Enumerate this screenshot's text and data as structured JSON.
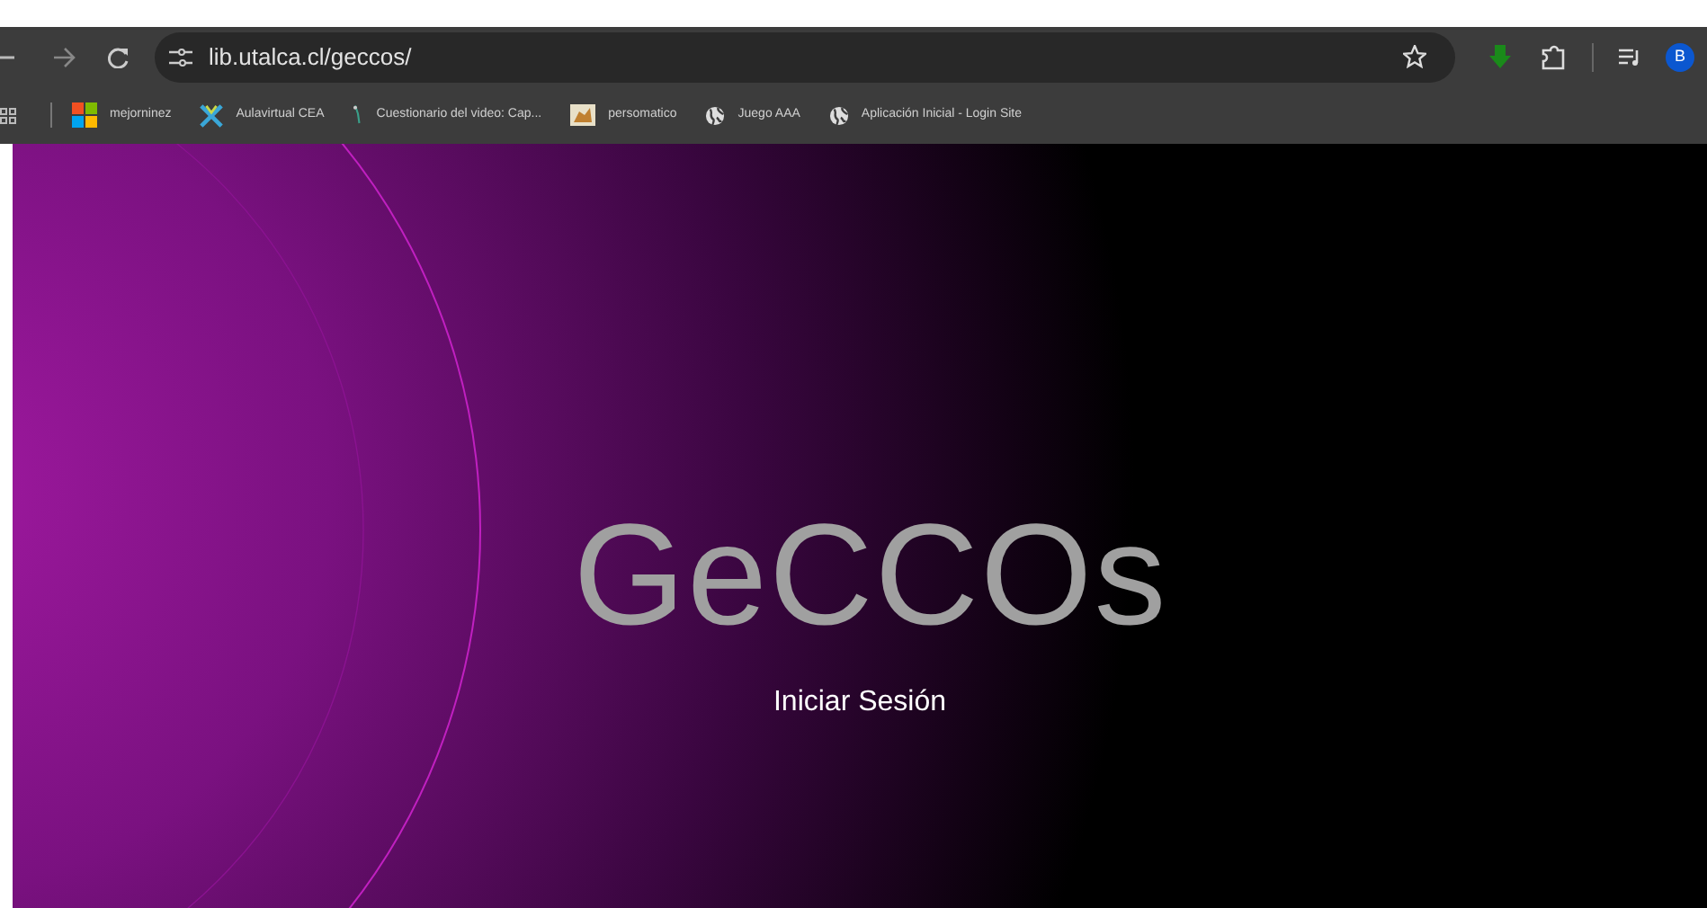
{
  "toolbar": {
    "url": "lib.utalca.cl/geccos/",
    "avatar": "B"
  },
  "bookmarks": [
    {
      "kind": "tiles",
      "label": "mejorninez"
    },
    {
      "kind": "cross",
      "label": "Aulavirtual CEA"
    },
    {
      "kind": "sprout",
      "label": "Cuestionario del video: Cap..."
    },
    {
      "kind": "picture",
      "label": "persomatico"
    },
    {
      "kind": "globe",
      "label": "Juego AAA"
    },
    {
      "kind": "globe",
      "label": "Aplicación Inicial - Login Site"
    }
  ],
  "page": {
    "title": "GeCCOs",
    "login": "Iniciar Sesión"
  }
}
